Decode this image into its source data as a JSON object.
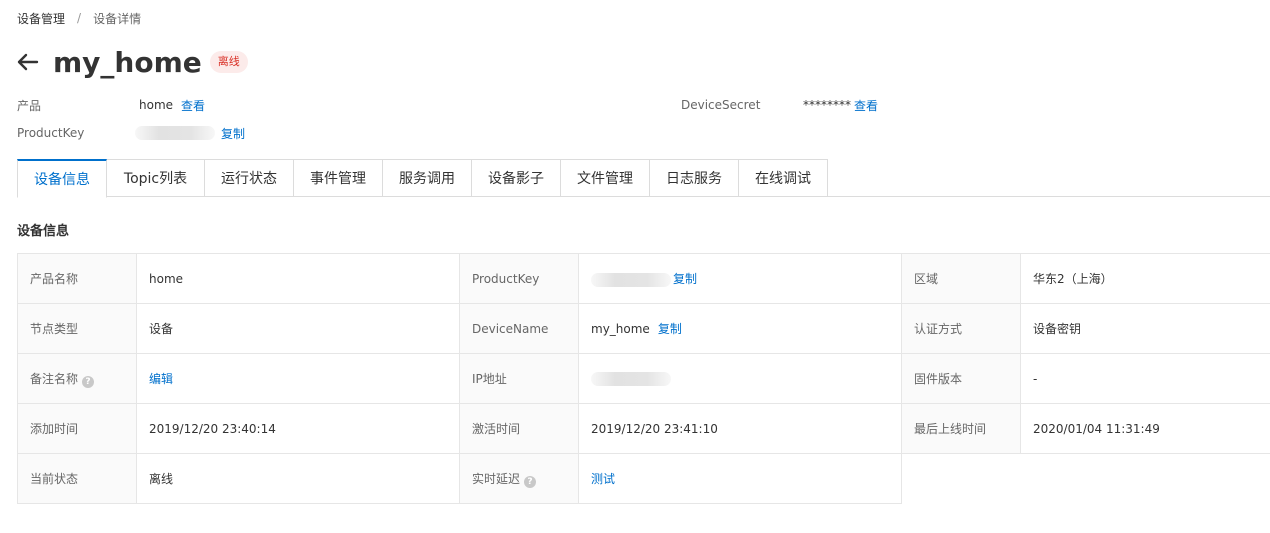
{
  "breadcrumb": {
    "items": [
      "设备管理",
      "设备详情"
    ],
    "separator": "/"
  },
  "header": {
    "title": "my_home",
    "status": "离线"
  },
  "meta": {
    "product_label": "产品",
    "product_value": "home",
    "product_link": "查看",
    "productkey_label": "ProductKey",
    "productkey_link": "复制",
    "devicesecret_label": "DeviceSecret",
    "devicesecret_value": "********",
    "devicesecret_link": "查看"
  },
  "tabs": [
    {
      "label": "设备信息"
    },
    {
      "label": "Topic列表"
    },
    {
      "label": "运行状态"
    },
    {
      "label": "事件管理"
    },
    {
      "label": "服务调用"
    },
    {
      "label": "设备影子"
    },
    {
      "label": "文件管理"
    },
    {
      "label": "日志服务"
    },
    {
      "label": "在线调试"
    }
  ],
  "section_title": "设备信息",
  "info": {
    "product_name_label": "产品名称",
    "product_name_value": "home",
    "productkey_label": "ProductKey",
    "productkey_link": "复制",
    "region_label": "区域",
    "region_value": "华东2（上海）",
    "node_type_label": "节点类型",
    "node_type_value": "设备",
    "devicename_label": "DeviceName",
    "devicename_value": "my_home",
    "devicename_link": "复制",
    "auth_label": "认证方式",
    "auth_value": "设备密钥",
    "remark_label": "备注名称",
    "remark_link": "编辑",
    "ip_label": "IP地址",
    "firmware_label": "固件版本",
    "firmware_value": "-",
    "added_label": "添加时间",
    "added_value": "2019/12/20 23:40:14",
    "activated_label": "激活时间",
    "activated_value": "2019/12/20 23:41:10",
    "last_online_label": "最后上线时间",
    "last_online_value": "2020/01/04 11:31:49",
    "current_status_label": "当前状态",
    "current_status_value": "离线",
    "latency_label": "实时延迟",
    "latency_link": "测试"
  },
  "help_glyph": "?",
  "colors": {
    "link": "#0070cc",
    "offline_badge_bg": "#fcebea",
    "offline_badge_text": "#d93026"
  }
}
